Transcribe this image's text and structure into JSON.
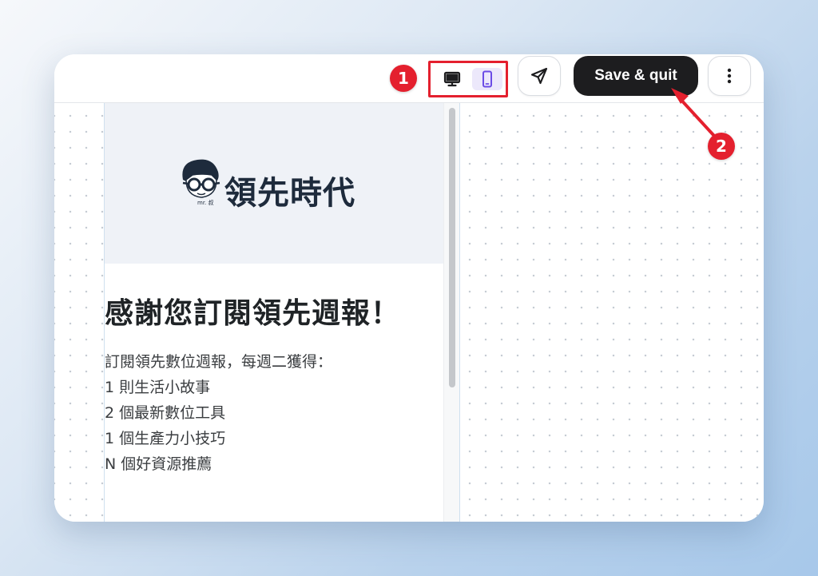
{
  "toolbar": {
    "device_toggle": {
      "desktop_icon": "monitor-icon",
      "mobile_icon": "smartphone-icon",
      "selected": "mobile"
    },
    "send_icon": "send-icon",
    "save_quit_label": "Save & quit",
    "more_icon": "more-vertical-icon"
  },
  "annotations": {
    "badge_1": "1",
    "badge_2": "2",
    "accent_color": "#e4202e"
  },
  "preview": {
    "logo_text": "領先時代",
    "logo_mark_text": "mr. 叔",
    "headline": "感謝您訂閱領先週報！",
    "body_lines": [
      "訂閱領先數位週報，每週二獲得：",
      "1 則生活小故事",
      "2 個最新數位工具",
      "1 個生產力小技巧",
      "N 個好資源推薦"
    ]
  }
}
